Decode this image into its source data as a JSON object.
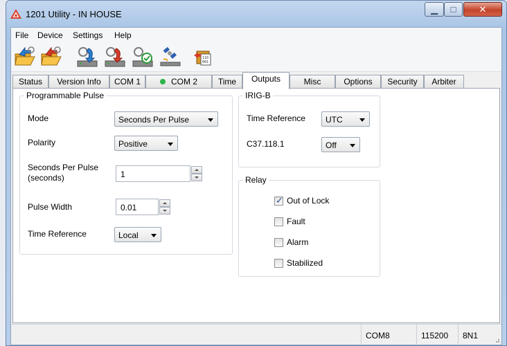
{
  "window": {
    "title": "1201 Utility - IN HOUSE"
  },
  "menu": [
    "File",
    "Device",
    "Settings",
    "Help"
  ],
  "toolbar": {
    "buttons": [
      "open-settings-icon",
      "save-settings-icon",
      "read-from-device-icon",
      "write-to-device-icon",
      "verify-icon",
      "satellite-icon",
      "firmware-icon"
    ]
  },
  "tabs": [
    {
      "label": "Status"
    },
    {
      "label": "Version Info"
    },
    {
      "label": "COM 1"
    },
    {
      "label": "COM 2"
    },
    {
      "label": "Time"
    },
    {
      "label": "Outputs"
    },
    {
      "label": "Misc"
    },
    {
      "label": "Options"
    },
    {
      "label": "Security"
    },
    {
      "label": "Arbiter"
    }
  ],
  "programmable_pulse": {
    "title": "Programmable Pulse",
    "mode_label": "Mode",
    "mode_value": "Seconds Per Pulse",
    "polarity_label": "Polarity",
    "polarity_value": "Positive",
    "seconds_label_1": "Seconds Per Pulse",
    "seconds_label_2": "(seconds)",
    "seconds_value": "1",
    "pulse_width_label": "Pulse Width",
    "pulse_width_value": "0.01",
    "time_ref_label": "Time Reference",
    "time_ref_value": "Local"
  },
  "irig": {
    "title": "IRIG-B",
    "time_ref_label": "Time Reference",
    "time_ref_value": "UTC",
    "c37_label": "C37.118.1",
    "c37_value": "Off"
  },
  "relay": {
    "title": "Relay",
    "items": [
      {
        "label": "Out of Lock",
        "checked": true
      },
      {
        "label": "Fault",
        "checked": false
      },
      {
        "label": "Alarm",
        "checked": false
      },
      {
        "label": "Stabilized",
        "checked": false
      }
    ]
  },
  "status": {
    "port": "COM8",
    "baud": "115200",
    "format": "8N1"
  },
  "colors": {
    "accent": "#2db34a",
    "title_bar": "#b7cfeb",
    "close": "#c3442c"
  }
}
